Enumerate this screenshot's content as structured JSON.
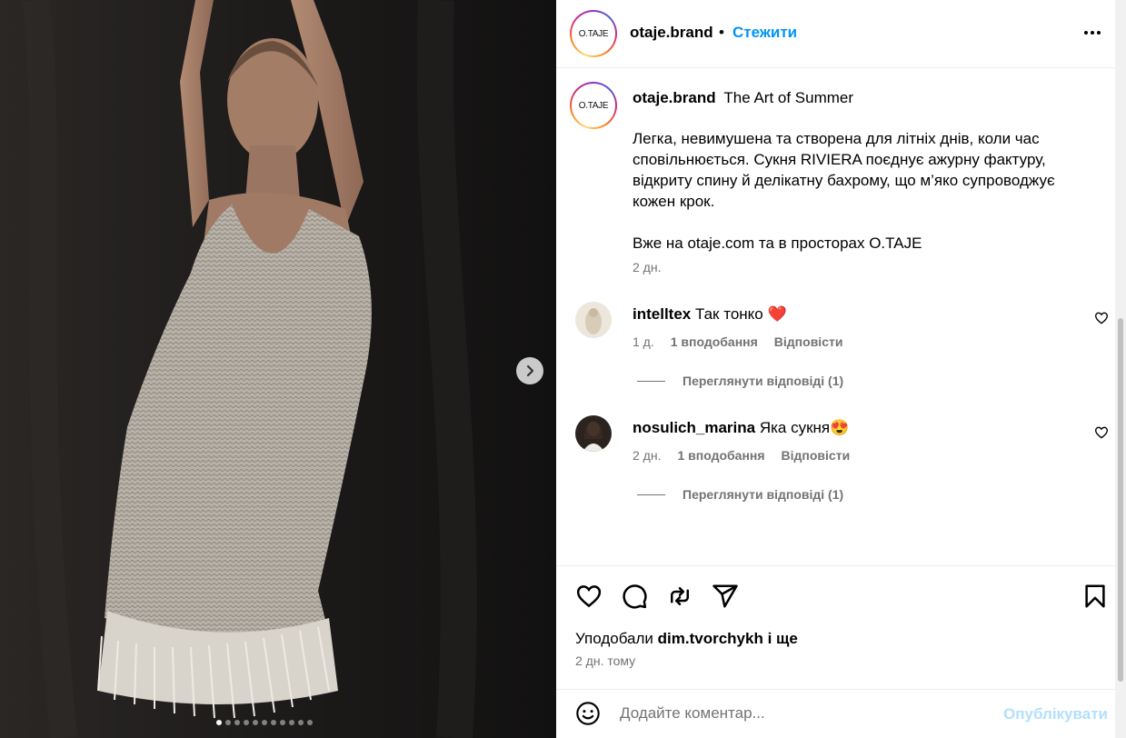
{
  "post": {
    "username": "otaje.brand",
    "avatar_logo": "O.TAJE",
    "follow_label": "Стежити",
    "separator": "•",
    "more_icon": "more-horizontal-icon"
  },
  "caption": {
    "username": "otaje.brand",
    "title": "The Art of Summer",
    "paragraphs": [
      "Легка, невимушена та створена для літніх днів, коли час сповільнюється. Сукня RIVIERA поєднує ажурну фактуру, відкриту спину й делікатну бахрому, що м’яко супроводжує кожен крок.",
      "Вже на otaje.com та в просторах O.TAJE"
    ],
    "time": "2 дн."
  },
  "comments": [
    {
      "username": "intelltex",
      "text": "Так тонко",
      "emoji": "❤️",
      "time": "1 д.",
      "likes": "1 вподобання",
      "reply_label": "Відповісти",
      "view_replies": "Переглянути відповіді (1)"
    },
    {
      "username": "nosulich_marina",
      "text": "Яка сукня",
      "emoji": "😍",
      "time": "2 дн.",
      "likes": "1 вподобання",
      "reply_label": "Відповісти",
      "view_replies": "Переглянути відповіді (1)"
    }
  ],
  "actions": {
    "icons": [
      "heart-icon",
      "comment-icon",
      "repost-icon",
      "share-icon",
      "bookmark-icon"
    ],
    "likes_prefix": "Уподобали",
    "likes_user": "dim.tvorchykh",
    "likes_suffix": "і ще",
    "post_time": "2 дн. тому"
  },
  "composer": {
    "placeholder": "Додайте коментар...",
    "publish_label": "Опублікувати"
  },
  "carousel": {
    "slide_count": 11,
    "active_index": 0
  },
  "colors": {
    "accent": "#0095f6",
    "publish_disabled": "#b2dffc",
    "secondary_text": "#737373",
    "like_red": "#ff3040"
  }
}
